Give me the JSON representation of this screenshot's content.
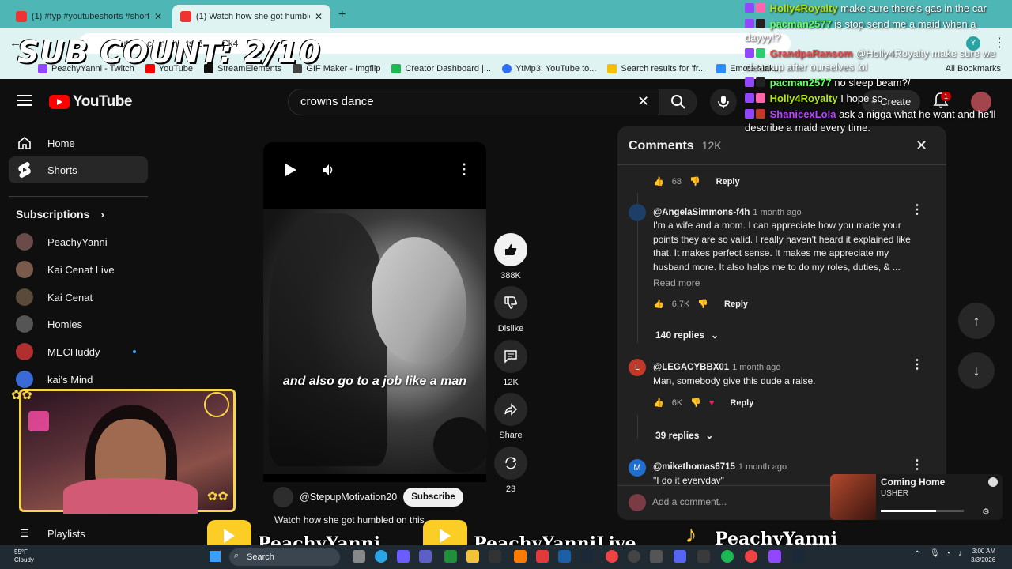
{
  "browser": {
    "tabs": [
      {
        "title": "(1) #fyp #youtubeshorts #shorts"
      },
      {
        "title": "(1) Watch how she got humbled"
      }
    ],
    "url": "youtube.com/shorts/Z7...ECk4",
    "bookmarks": [
      "PeachyYanni - Twitch",
      "YouTube",
      "StreamElements",
      "GIF Maker - Imgflip",
      "Creator Dashboard |...",
      "YtMp3: YouTube to...",
      "Search results for 'fr...",
      "Emote Mak...",
      "All Bookmarks"
    ],
    "bookmark_colors": [
      "#9146ff",
      "#ff0000",
      "#111111",
      "#444444",
      "#1db954",
      "#2d6ff5",
      "#f5c000",
      "#2d8cff",
      "#555555"
    ]
  },
  "overlay": {
    "sub_count": "SUB COUNT: 2/10"
  },
  "youtube": {
    "logo": "YouTube",
    "search_query": "crowns dance",
    "create_label": "Create",
    "notification_count": "1",
    "sidebar": {
      "items": [
        {
          "label": "Home",
          "icon": "home-icon"
        },
        {
          "label": "Shorts",
          "icon": "shorts-icon"
        }
      ],
      "subscriptions_label": "Subscriptions",
      "subscriptions": [
        {
          "label": "PeachyYanni",
          "color": "#6b4a4a"
        },
        {
          "label": "Kai Cenat Live",
          "color": "#7a5a4a"
        },
        {
          "label": "Kai Cenat",
          "color": "#5a4a3a"
        },
        {
          "label": "Homies",
          "color": "#555555"
        },
        {
          "label": "MECHuddy",
          "color": "#b03030"
        },
        {
          "label": "kai's Mind",
          "color": "#3a6ad6"
        }
      ],
      "playlists_label": "Playlists"
    },
    "short": {
      "caption": "and also go to a job like a man",
      "channel": "@StepupMotivation20",
      "subscribe_label": "Subscribe",
      "title": "Watch how she got humbled on this...",
      "likes": "388K",
      "dislike_label": "Dislike",
      "comments_count": "12K",
      "share_label": "Share",
      "remix_count": "23"
    },
    "comments": {
      "title": "Comments",
      "count": "12K",
      "top_partial": {
        "likes": "68",
        "reply_label": "Reply"
      },
      "items": [
        {
          "author": "@AngelaSimmons-f4h",
          "time": "1 month ago",
          "text": "I'm a wife and a mom. I can appreciate how you made your points they are so valid.  I really haven't heard it explained like that.  It makes perfect sense. It makes me appreciate my husband more. It also helps me to do my roles, duties, & ...",
          "read_more": "Read more",
          "likes": "6.7K",
          "reply_label": "Reply",
          "replies": "140 replies",
          "avatar_letter": "",
          "avatar_color": "#1d3e66"
        },
        {
          "author": "@LEGACYBBX01",
          "time": "1 month ago",
          "text": "Man, somebody give this dude a raise.",
          "likes": "6K",
          "reply_label": "Reply",
          "replies": "39 replies",
          "avatar_letter": "L",
          "avatar_color": "#c0392b"
        },
        {
          "author": "@mikethomas6715",
          "time": "1 month ago",
          "text": "\"I do it everyday\"",
          "avatar_letter": "M",
          "avatar_color": "#1e6fd0"
        }
      ],
      "add_placeholder": "Add a comment..."
    }
  },
  "chat": [
    {
      "user": "Holly4Royalty",
      "color": "#b5e61d",
      "text": "make sure there's gas in the car"
    },
    {
      "user": "pacman2577",
      "color": "#66ff66",
      "text": "is stop send me a maid when a dayyy!?"
    },
    {
      "user": "GrandpaRansom",
      "color": "#ff4444",
      "text": "@Holly4Royalty make sure we clean up after ourselves lol"
    },
    {
      "user": "pacman2577",
      "color": "#66ff66",
      "text": "no sleep beam?/"
    },
    {
      "user": "Holly4Royalty",
      "color": "#b5e61d",
      "text": "I hope so"
    },
    {
      "user": "ShanicexLola",
      "color": "#bb44ff",
      "text": "ask a nigga what he want and he'll describe a maid every time."
    }
  ],
  "music": {
    "title": "Coming Home",
    "artist": "USHER",
    "progress": 0.67
  },
  "banners": {
    "yt_name": "PeachyYanni",
    "yt_live": "PeachyYanniLive",
    "tiktok_name": "PeachyYanni"
  },
  "taskbar": {
    "temp": "55°F",
    "weather": "Cloudy",
    "search_label": "Search",
    "time": "3:00 AM",
    "date": "3/3/2026"
  }
}
